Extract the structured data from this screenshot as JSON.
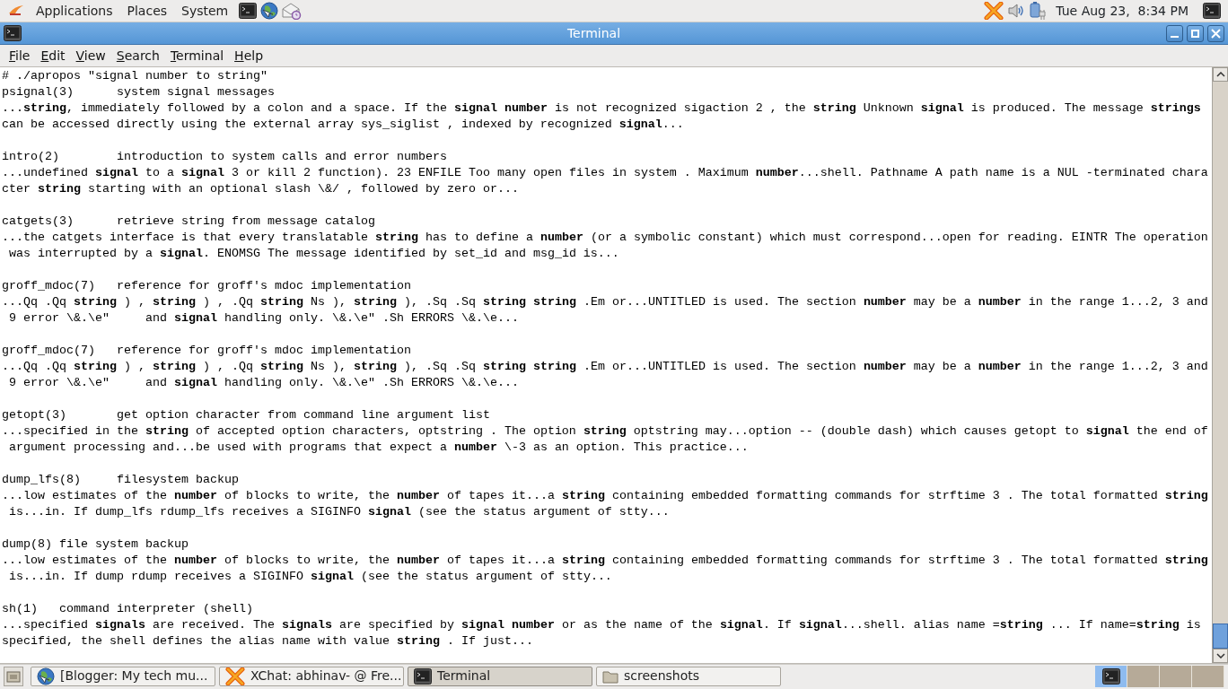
{
  "top_panel": {
    "menus": [
      "Applications",
      "Places",
      "System"
    ],
    "launchers": [
      {
        "kind": "terminal"
      },
      {
        "kind": "browser"
      },
      {
        "kind": "mail"
      }
    ],
    "tray": [
      {
        "kind": "chat"
      },
      {
        "kind": "volume"
      },
      {
        "kind": "power"
      }
    ],
    "clock": "Tue Aug 23,  8:34 PM"
  },
  "window": {
    "title": "Terminal"
  },
  "menu_bar": [
    "File",
    "Edit",
    "View",
    "Search",
    "Terminal",
    "Help"
  ],
  "terminal": {
    "command": "# ./apropos \"signal number to string\"",
    "results": [
      {
        "header": "psignal(3)      system signal messages",
        "lines": [
          "...**string**, immediately followed by a colon and a space. If the **signal number** is not recognized sigaction 2 , the **string** Unknown **signal** is produced. The message **strings**",
          "can be accessed directly using the external array sys_siglist , indexed by recognized **signal**..."
        ]
      },
      {
        "header": "intro(2)        introduction to system calls and error numbers",
        "lines": [
          "...undefined **signal** to a **signal** 3 or kill 2 function). 23 ENFILE Too many open files in system . Maximum **number**...shell. Pathname A path name is a NUL -terminated chara",
          "cter **string** starting with an optional slash \\&/ , followed by zero or..."
        ]
      },
      {
        "header": "catgets(3)      retrieve string from message catalog",
        "lines": [
          "...the catgets interface is that every translatable **string** has to define a **number** (or a symbolic constant) which must correspond...open for reading. EINTR The operation",
          " was interrupted by a **signal**. ENOMSG The message identified by set_id and msg_id is..."
        ]
      },
      {
        "header": "groff_mdoc(7)   reference for groff's mdoc implementation",
        "lines": [
          "...Qq .Qq **string** ) , **string** ) , .Qq **string** Ns ), **string** ), .Sq .Sq **string string** .Em or...UNTITLED is used. The section **number** may be a **number** in the range 1...2, 3 and",
          " 9 error \\&.\\e\"     and **signal** handling only. \\&.\\e\" .Sh ERRORS \\&.\\e..."
        ]
      },
      {
        "header": "groff_mdoc(7)   reference for groff's mdoc implementation",
        "lines": [
          "...Qq .Qq **string** ) , **string** ) , .Qq **string** Ns ), **string** ), .Sq .Sq **string string** .Em or...UNTITLED is used. The section **number** may be a **number** in the range 1...2, 3 and",
          " 9 error \\&.\\e\"     and **signal** handling only. \\&.\\e\" .Sh ERRORS \\&.\\e..."
        ]
      },
      {
        "header": "getopt(3)       get option character from command line argument list",
        "lines": [
          "...specified in the **string** of accepted option characters, optstring . The option **string** optstring may...option -- (double dash) which causes getopt to **signal** the end of",
          " argument processing and...be used with programs that expect a **number** \\-3 as an option. This practice..."
        ]
      },
      {
        "header": "dump_lfs(8)     filesystem backup",
        "lines": [
          "...low estimates of the **number** of blocks to write, the **number** of tapes it...a **string** containing embedded formatting commands for strftime 3 . The total formatted **string**",
          " is...in. If dump_lfs rdump_lfs receives a SIGINFO **signal** (see the status argument of stty..."
        ]
      },
      {
        "header": "dump(8) file system backup",
        "lines": [
          "...low estimates of the **number** of blocks to write, the **number** of tapes it...a **string** containing embedded formatting commands for strftime 3 . The total formatted **string**",
          " is...in. If dump rdump receives a SIGINFO **signal** (see the status argument of stty..."
        ]
      },
      {
        "header": "sh(1)   command interpreter (shell)",
        "lines": [
          "...specified **signals** are received. The **signals** are specified by **signal number** or as the name of the **signal**. If **signal**...shell. alias name =**string** ... If name=**string** is",
          "specified, the shell defines the alias name with value **string** . If just..."
        ]
      }
    ]
  },
  "taskbar": {
    "tasks": [
      {
        "label": "[Blogger: My tech mu...",
        "kind": "browser",
        "selected": false
      },
      {
        "label": "XChat: abhinav- @ Fre...",
        "kind": "chat",
        "selected": false
      },
      {
        "label": "Terminal",
        "kind": "terminal",
        "selected": true
      },
      {
        "label": "screenshots",
        "kind": "folder",
        "selected": false
      }
    ],
    "workspaces": [
      {
        "selected": true
      },
      {
        "selected": false
      },
      {
        "selected": false
      },
      {
        "selected": false
      }
    ]
  }
}
